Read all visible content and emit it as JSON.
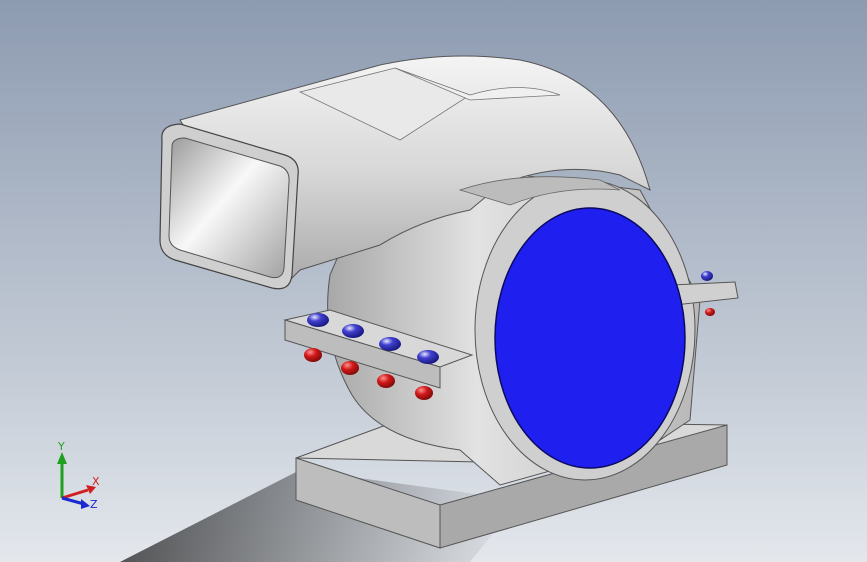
{
  "colors": {
    "background_top": "#8f9db2",
    "background_bottom": "#dfe4ea",
    "body": "#c9c9c9",
    "face": "#1f1ff0",
    "bolt": "#2a2ab8",
    "nut": "#d41818",
    "axis_x": "#d02020",
    "axis_y": "#20a020",
    "axis_z": "#1a2ad0"
  },
  "triad": {
    "x_label": "X",
    "y_label": "Y",
    "z_label": "Z"
  },
  "model": {
    "parts": [
      "base-plate",
      "housing-cylinder",
      "flange-plate",
      "outlet-duct",
      "blue-face",
      "bolt-heads",
      "nuts"
    ]
  }
}
